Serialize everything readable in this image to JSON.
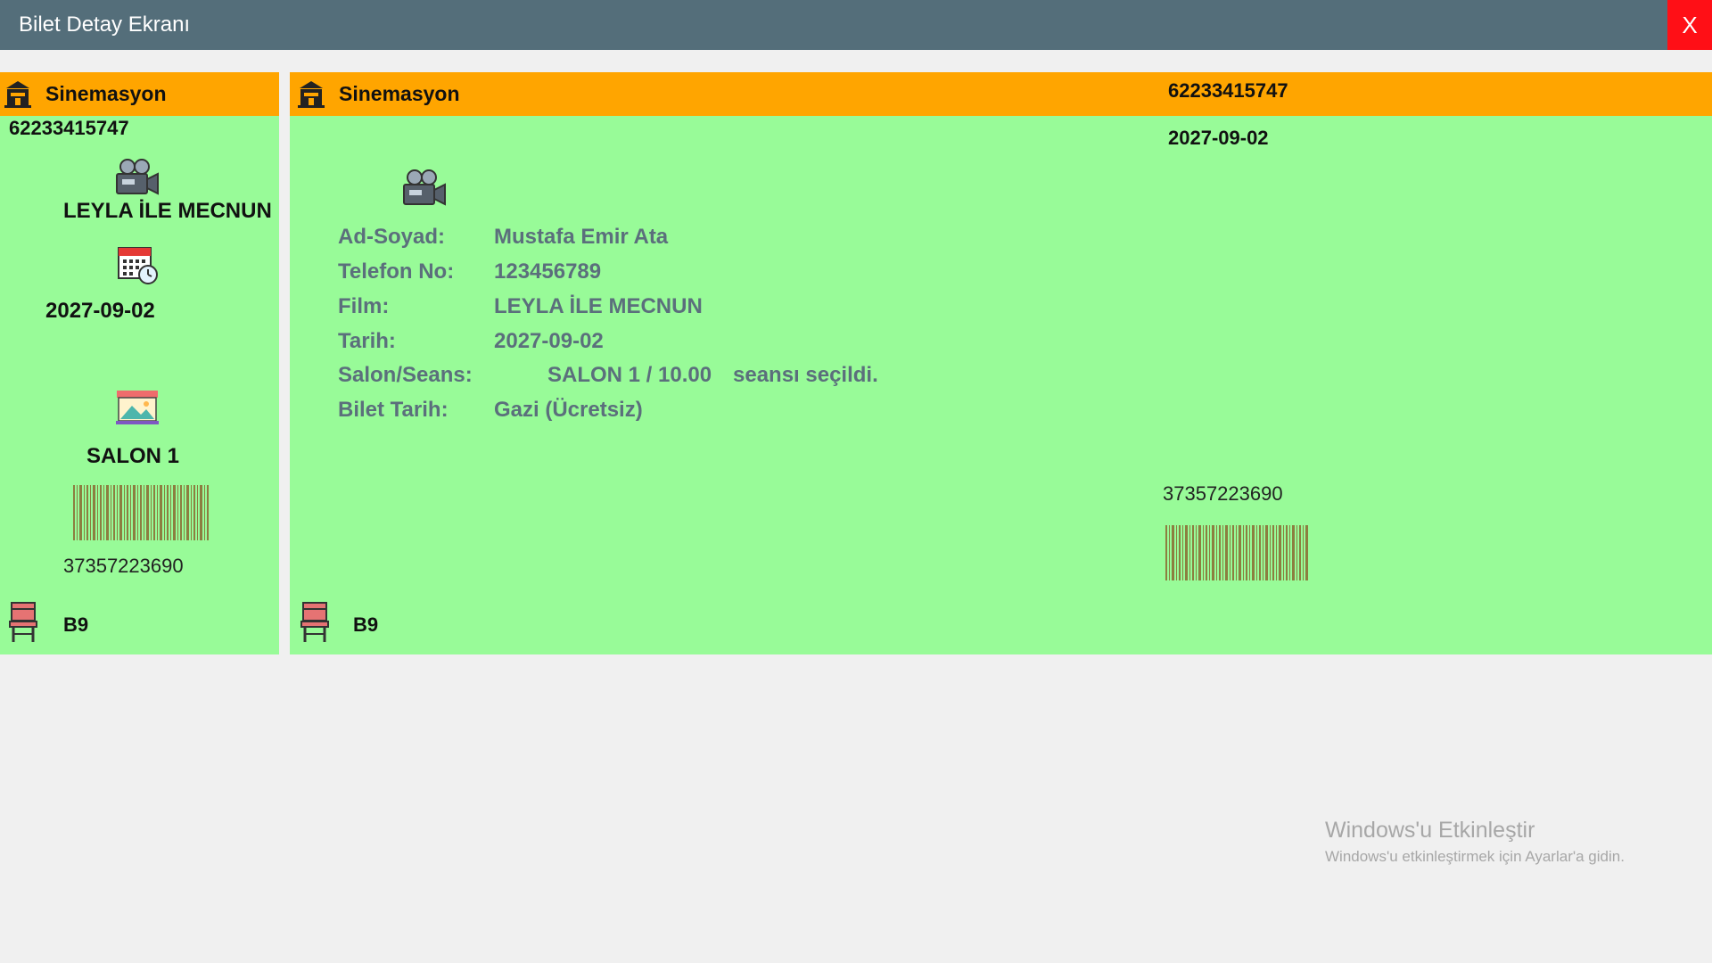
{
  "window": {
    "title": "Bilet Detay Ekranı",
    "close_label": "X"
  },
  "stub": {
    "brand": "Sinemasyon",
    "ticket_no": "62233415747",
    "film": "LEYLA İLE MECNUN",
    "date": "2027-09-02",
    "hall": "SALON 1",
    "barcode_number": "37357223690",
    "seat": "B9"
  },
  "ticket": {
    "brand": "Sinemasyon",
    "ticket_no": "62233415747",
    "date": "2027-09-02",
    "labels": {
      "name": "Ad-Soyad:",
      "phone": "Telefon No:",
      "film": "Film:",
      "date": "Tarih:",
      "hall_session": "Salon/Seans:",
      "ticket_type": "Bilet Tarih:"
    },
    "values": {
      "name": "Mustafa Emir Ata",
      "phone": "123456789",
      "film": "LEYLA İLE MECNUN",
      "date": "2027-09-02",
      "hall_session": "SALON 1 / 10.00",
      "hall_session_suffix": "seansı seçildi.",
      "ticket_type": "Gazi (Ücretsiz)"
    },
    "barcode_number": "37357223690",
    "seat": "B9"
  },
  "watermark": {
    "title": "Windows'u Etkinleştir",
    "subtitle": "Windows'u etkinleştirmek için Ayarlar'a gidin."
  },
  "colors": {
    "titlebar": "#546e7a",
    "close": "#ff0f16",
    "band": "#ffa500",
    "ticket_bg": "#98fb98"
  },
  "icons": [
    "cinema-building-icon",
    "movie-camera-icon",
    "calendar-clock-icon",
    "cinema-screen-icon",
    "chair-icon",
    "barcode-icon"
  ]
}
